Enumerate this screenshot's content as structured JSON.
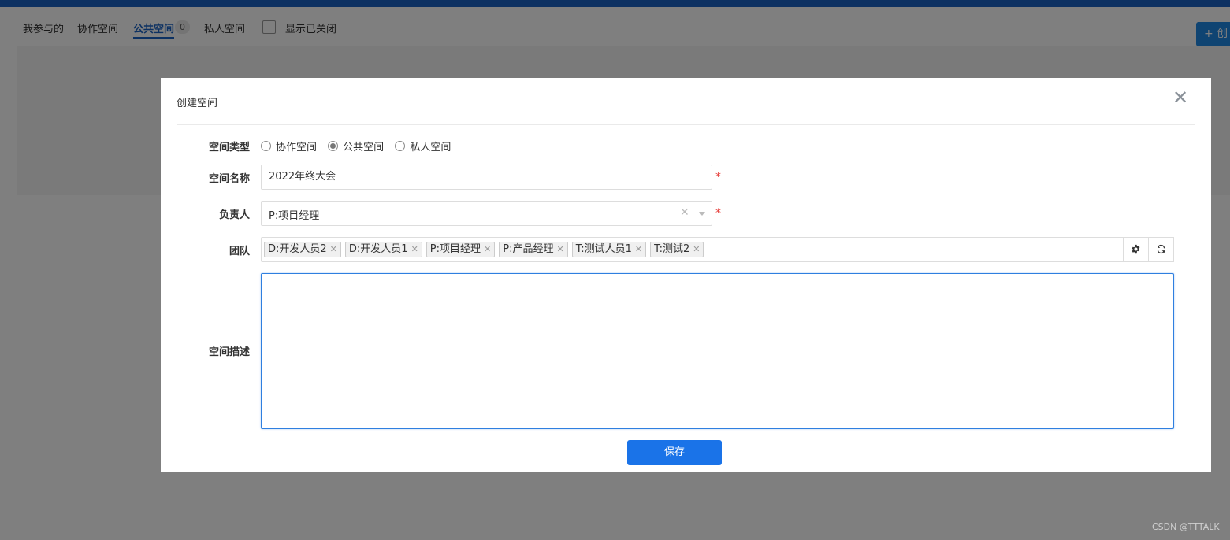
{
  "app_tabs": {
    "mine": "我参与的",
    "collab": "协作空间",
    "public": "公共空间",
    "public_count": "0",
    "private": "私人空间",
    "show_closed": "显示已关闭"
  },
  "create_button_label": "+ 创",
  "modal": {
    "title": "创建空间",
    "close_icon": "close-icon",
    "space_type": {
      "label": "空间类型",
      "options": [
        "协作空间",
        "公共空间",
        "私人空间"
      ],
      "selected": "公共空间"
    },
    "space_name": {
      "label": "空间名称",
      "value": "2022年终大会",
      "required_mark": "*"
    },
    "owner": {
      "label": "负责人",
      "value": "P:项目经理",
      "required_mark": "*"
    },
    "team": {
      "label": "团队",
      "tags": [
        "D:开发人员2",
        "D:开发人员1",
        "P:项目经理",
        "P:产品经理",
        "T:测试人员1",
        "T:测试2"
      ],
      "settings_icon": "gear-icon",
      "refresh_icon": "refresh-icon"
    },
    "description": {
      "label": "空间描述",
      "value": ""
    },
    "save_label": "保存"
  },
  "watermark": "CSDN @TTTALK",
  "colors": {
    "accent": "#1a73e8",
    "topbar": "#1a63c4",
    "required": "#e53935",
    "overlay": "rgba(0,0,0,0.5)"
  }
}
